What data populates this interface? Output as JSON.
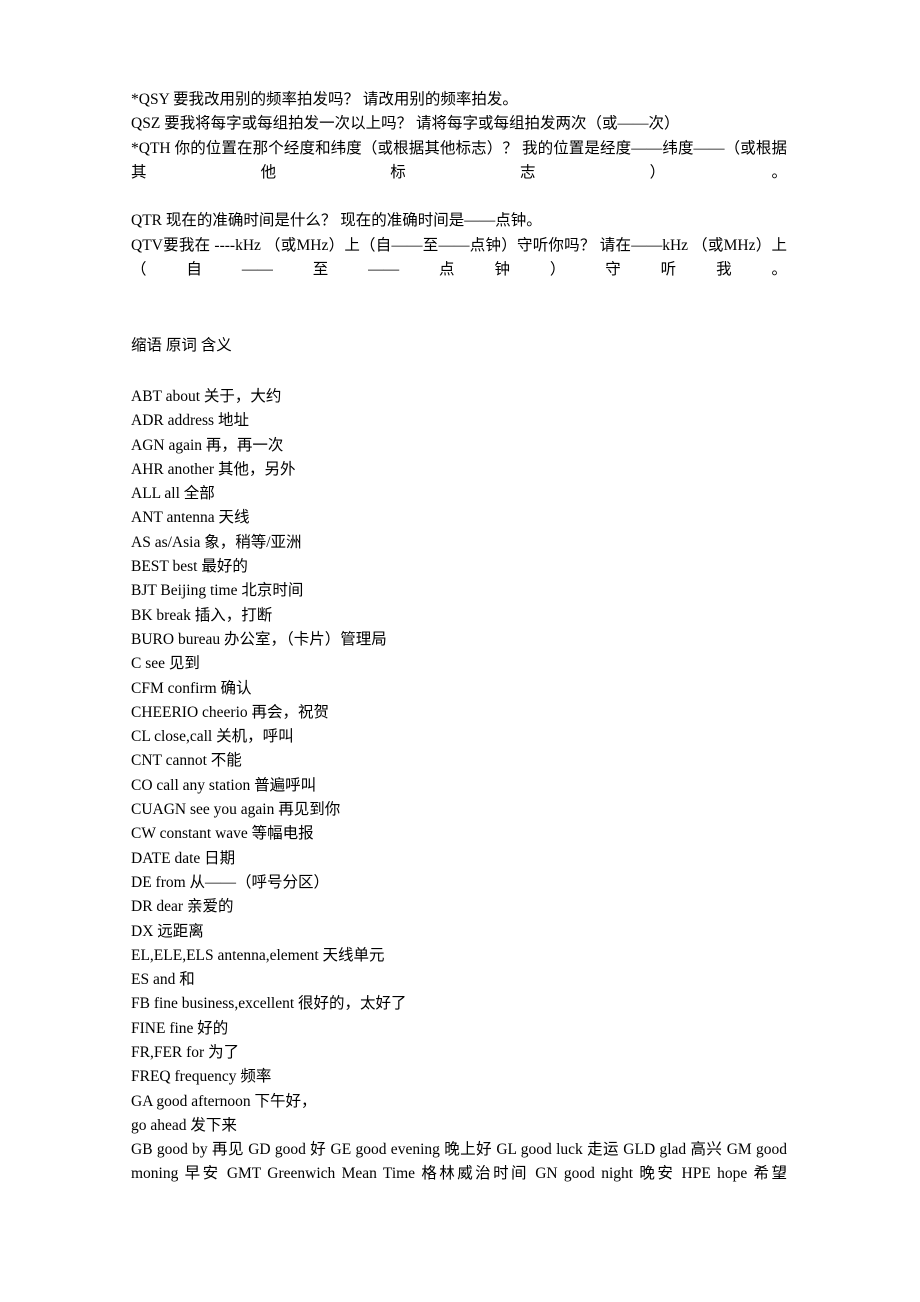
{
  "document": {
    "q_codes": [
      "*QSY 要我改用别的频率拍发吗？  请改用别的频率拍发。",
      "QSZ 要我将每字或每组拍发一次以上吗？  请将每字或每组拍发两次（或——次）",
      "*QTH 你的位置在那个经度和纬度（或根据其他标志）？  我的位置是经度——纬度——（或根据其他标志）。",
      "QTR 现在的准确时间是什么？  现在的准确时间是——点钟。",
      "QTV要我在 ----kHz （或MHz）上（自——至——点钟）守听你吗？  请在——kHz （或MHz）上（自——至——点钟）守听我。"
    ],
    "section_heading": "缩语  原词  含义",
    "abbreviations": [
      "ABT about 关于，大约",
      "ADR address 地址",
      "AGN again 再，再一次",
      "AHR another 其他，另外",
      "ALL all 全部",
      "ANT antenna 天线",
      "AS as/Asia 象，稍等/亚洲",
      "BEST best 最好的",
      "BJT Beijing time 北京时间",
      "BK break 插入，打断",
      "BURO bureau 办公室，（卡片）管理局",
      "C see 见到",
      "CFM confirm 确认",
      "CHEERIO cheerio 再会，祝贺",
      "CL close,call 关机，呼叫",
      "CNT cannot 不能",
      "CO call any station 普遍呼叫",
      "CUAGN see you again 再见到你",
      "CW constant wave 等幅电报",
      "DATE date 日期",
      "DE from 从——（呼号分区）",
      "DR dear 亲爱的",
      "DX 远距离",
      "EL,ELE,ELS antenna,element 天线单元",
      "ES and 和",
      "FB fine business,excellent 很好的，太好了",
      "FINE fine 好的",
      "FR,FER for 为了",
      "FREQ frequency 频率",
      "GA good afternoon 下午好，",
      "go ahead 发下来"
    ],
    "tail_paragraph": "GB good by 再见  GD good 好  GE good evening 晚上好  GL good luck 走运  GLD glad 高兴  GM good moning 早安  GMT Greenwich Mean Time 格林威治时间  GN good night 晚安  HPE hope 希望"
  }
}
